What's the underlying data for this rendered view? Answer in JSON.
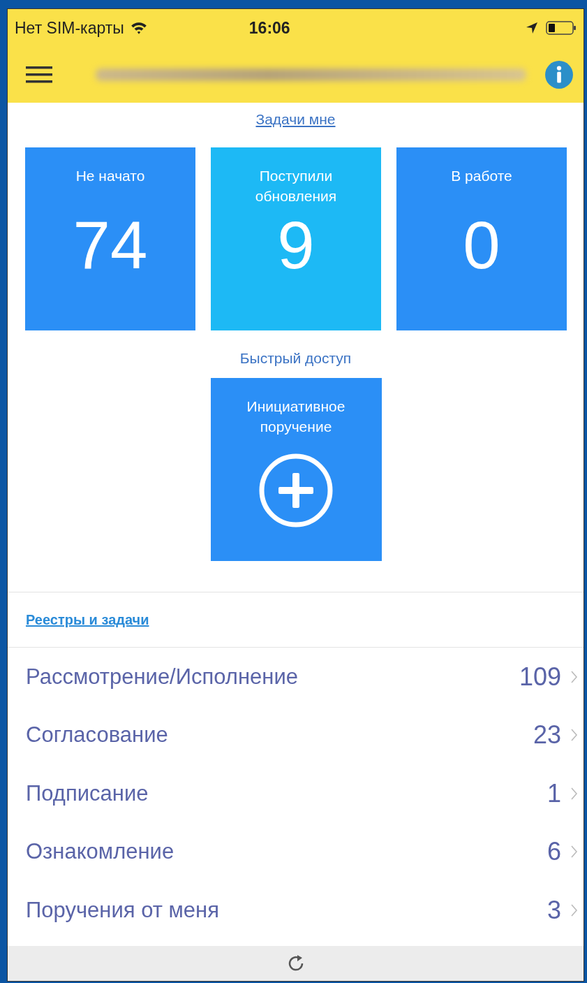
{
  "status_bar": {
    "carrier": "Нет SIM-карты",
    "time": "16:06"
  },
  "tasks_heading": "Задачи мне",
  "task_tiles": [
    {
      "label": "Не начато",
      "count": "74",
      "color": "#2b8ff6"
    },
    {
      "label": "Поступили обновления",
      "count": "9",
      "color": "#1db9f5"
    },
    {
      "label": "В работе",
      "count": "0",
      "color": "#2b8ff6"
    }
  ],
  "quick_access_heading": "Быстрый доступ",
  "quick_tiles": [
    {
      "label": "Инициативное поручение"
    }
  ],
  "registers_heading": "Реестры и задачи",
  "registers": [
    {
      "label": "Рассмотрение/Исполнение",
      "count": "109"
    },
    {
      "label": "Согласование",
      "count": "23"
    },
    {
      "label": "Подписание",
      "count": "1"
    },
    {
      "label": "Ознакомление",
      "count": "6"
    },
    {
      "label": "Поручения от меня",
      "count": "3"
    }
  ]
}
